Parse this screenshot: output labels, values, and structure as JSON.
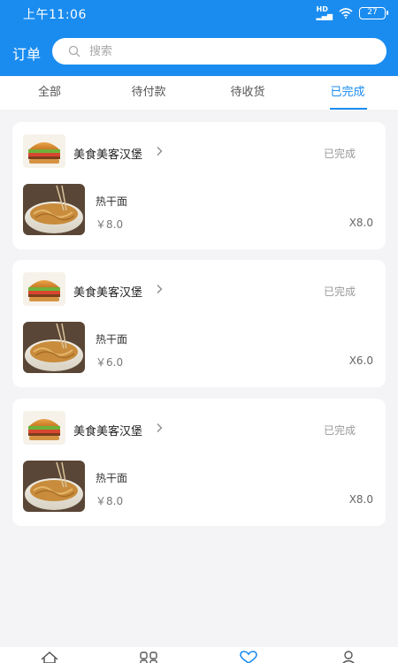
{
  "status_bar": {
    "time": "上午11:06",
    "battery": "27"
  },
  "header": {
    "title": "订单",
    "search_placeholder": "搜索"
  },
  "tabs": [
    {
      "label": "全部",
      "active": false
    },
    {
      "label": "待付款",
      "active": false
    },
    {
      "label": "待收货",
      "active": false
    },
    {
      "label": "已完成",
      "active": true
    }
  ],
  "orders": [
    {
      "shop": "美食美客汉堡",
      "status": "已完成",
      "item": "热干面",
      "price": "￥8.0",
      "qty": "X8.0"
    },
    {
      "shop": "美食美客汉堡",
      "status": "已完成",
      "item": "热干面",
      "price": "￥6.0",
      "qty": "X6.0"
    },
    {
      "shop": "美食美客汉堡",
      "status": "已完成",
      "item": "热干面",
      "price": "￥8.0",
      "qty": "X8.0"
    }
  ],
  "bottom_nav": [
    {
      "icon": "home-icon"
    },
    {
      "icon": "category-icon"
    },
    {
      "icon": "heart-icon"
    },
    {
      "icon": "user-icon"
    }
  ],
  "colors": {
    "primary": "#1a8cf0",
    "background": "#f4f4f6"
  }
}
